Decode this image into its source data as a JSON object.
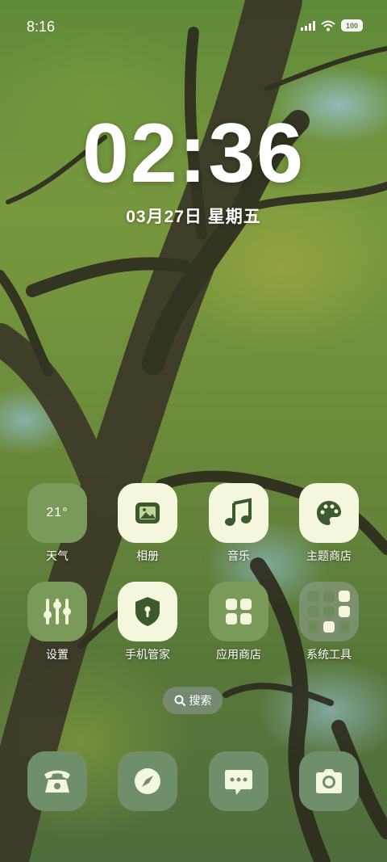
{
  "status_bar": {
    "time": "8:16",
    "battery": "100"
  },
  "lockclock": {
    "time": "02:36",
    "date": "03月27日 星期五"
  },
  "weather": {
    "temp": "21°"
  },
  "apps": {
    "row1": [
      {
        "label": "天气",
        "icon": "weather-widget"
      },
      {
        "label": "相册",
        "icon": "gallery-icon"
      },
      {
        "label": "音乐",
        "icon": "music-note-icon"
      },
      {
        "label": "主题商店",
        "icon": "palette-icon"
      }
    ],
    "row2": [
      {
        "label": "设置",
        "icon": "sliders-icon"
      },
      {
        "label": "手机管家",
        "icon": "shield-icon"
      },
      {
        "label": "应用商店",
        "icon": "app-grid-icon"
      },
      {
        "label": "系统工具",
        "icon": "folder-icon"
      }
    ]
  },
  "search": {
    "label": "搜索"
  },
  "dock": [
    {
      "name": "phone",
      "icon": "telephone-icon"
    },
    {
      "name": "browser",
      "icon": "compass-icon"
    },
    {
      "name": "messages",
      "icon": "chat-bubble-icon"
    },
    {
      "name": "camera",
      "icon": "camera-icon"
    }
  ],
  "colors": {
    "tile_green": "#7a9a5a",
    "tile_cream": "#f4f7de",
    "tile_sage": "#6f8e6a",
    "icon_dark": "#3d5a2c"
  }
}
